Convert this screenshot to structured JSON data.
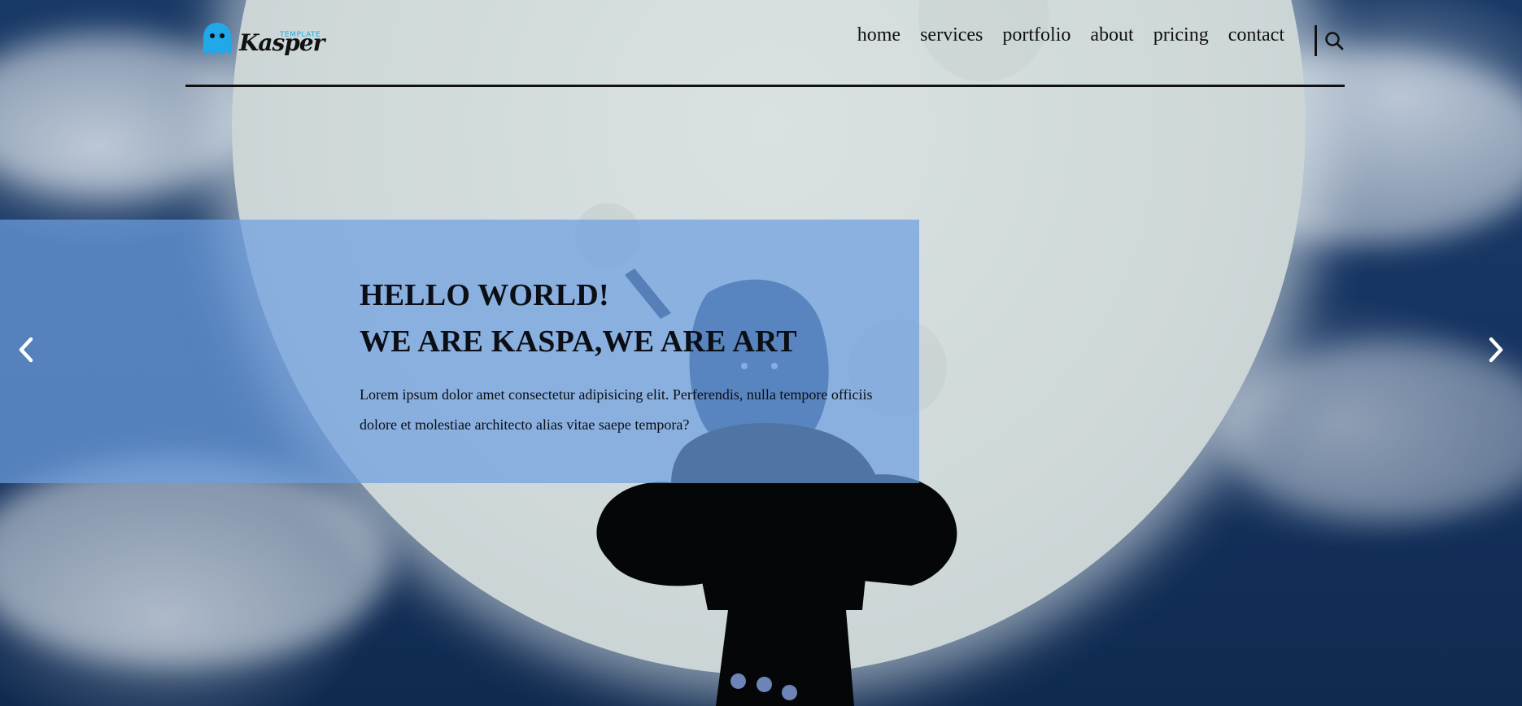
{
  "header": {
    "logo": {
      "tag": "TEMPLATE",
      "word": "Kasper",
      "ghost_icon": "ghost-icon",
      "accent": "#20a8e8"
    },
    "nav": [
      {
        "label": "home"
      },
      {
        "label": "services"
      },
      {
        "label": "portfolio"
      },
      {
        "label": "about"
      },
      {
        "label": "pricing"
      },
      {
        "label": "contact"
      }
    ],
    "search_icon": "search-icon"
  },
  "hero": {
    "title_line1": "HELLO WORLD!",
    "title_line2": "WE ARE KASPA,WE ARE ART",
    "text": "Lorem ipsum dolor amet consectetur adipisicing elit. Perferendis, nulla tempore officiis dolore et molestiae architecto alias vitae saepe tempora?",
    "prev_icon": "chevron-left-icon",
    "next_icon": "chevron-right-icon",
    "banner_color": "#6ea0e1",
    "slides_count": 3
  }
}
